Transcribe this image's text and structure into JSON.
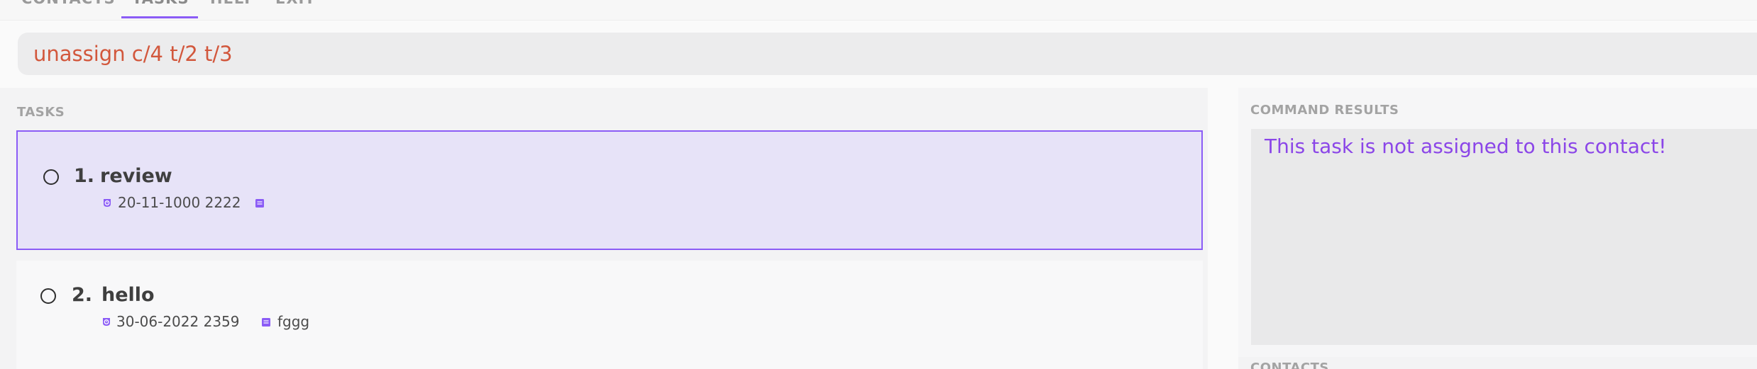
{
  "nav": {
    "tabs": [
      {
        "label": "CONTACTS"
      },
      {
        "label": "TASKS"
      },
      {
        "label": "HELP"
      },
      {
        "label": "EXIT"
      }
    ]
  },
  "command": {
    "value": "unassign c/4 t/2 t/3"
  },
  "tasks_panel": {
    "heading": "TASKS",
    "tasks": [
      {
        "index": "1.",
        "name": "review",
        "deadline": "20-11-1000 2222",
        "description": ""
      },
      {
        "index": "2.",
        "name": "hello",
        "deadline": "30-06-2022 2359",
        "description": "fggg"
      }
    ]
  },
  "results_panel": {
    "heading": "COMMAND RESULTS",
    "message": "This task is not assigned to this contact!"
  },
  "contacts_panel": {
    "heading": "CONTACTS"
  },
  "colors": {
    "accent": "#8b5cf6",
    "command_text": "#d2573c",
    "result_text": "#8b46e8",
    "selected_bg": "#e7e3f8"
  },
  "icons": {
    "deadline": "deadline-badge-icon",
    "description": "description-note-icon"
  }
}
